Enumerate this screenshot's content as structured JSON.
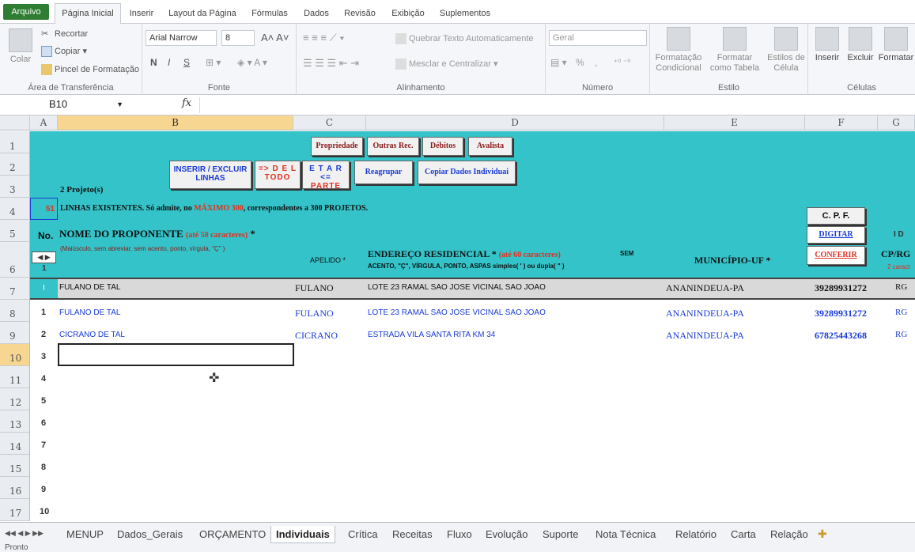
{
  "ribbon_tabs": [
    "Arquivo",
    "Página Inicial",
    "Inserir",
    "Layout da Página",
    "Fórmulas",
    "Dados",
    "Revisão",
    "Exibição",
    "Suplementos"
  ],
  "clipboard": {
    "paste": "Colar",
    "cut": "Recortar",
    "copy": "Copiar ▾",
    "format_painter": "Pincel de Formatação",
    "label": "Área de Transferência"
  },
  "font": {
    "name": "Arial Narrow",
    "size": "8",
    "bold": "N",
    "italic": "I",
    "underline": "S",
    "label": "Fonte"
  },
  "alignment": {
    "wrap": "Quebrar Texto Automaticamente",
    "merge": "Mesclar e Centralizar",
    "label": "Alinhamento"
  },
  "number": {
    "format": "Geral",
    "percent": "%",
    "comma": ",",
    "label": "Número"
  },
  "styles": {
    "conditional": "Formatação Condicional",
    "table": "Formatar como Tabela",
    "cell_styles": "Estilos de Célula",
    "label": "Estilo"
  },
  "cells": {
    "insert": "Inserir",
    "delete": "Excluir",
    "format": "Formatar",
    "label": "Células"
  },
  "formula_bar": {
    "name_box": "B10",
    "fx": "fx"
  },
  "columns": [
    "A",
    "B",
    "C",
    "D",
    "E",
    "F",
    "G"
  ],
  "rows": [
    "1",
    "2",
    "3",
    "4",
    "5",
    "6",
    "7",
    "8",
    "9",
    "10",
    "11",
    "12",
    "13",
    "14",
    "15",
    "16",
    "17"
  ],
  "buttons": {
    "propriedade": "Propriedade",
    "outras": "Outras Rec.",
    "debitos": "Débitos",
    "avalista": "Avalista",
    "inserir": "INSERIR / EXCLUIR LINHAS",
    "deletar_todo_1": "=> D E L",
    "deletar_todo_2": "TODO",
    "deletar_parte_1": "E T A R <=",
    "deletar_parte_2": "PARTE",
    "reagrupar": "Reagrupar",
    "copiar": "Copiar Dados Individuai",
    "digitar": "DIGITAR",
    "conferir": "CONFERIR"
  },
  "sheet": {
    "projetos": "2 Projeto(s)",
    "count": "51",
    "linhas_pre": "LINHAS EXISTENTES.  Só admite, no ",
    "maximo": "MÁXIMO  300",
    "linhas_post": ", correspondentes a 300 PROJETOS.",
    "no": "No.",
    "nome_header": "NOME DO PROPONENTE",
    "nome_limit": "(até 50 caracteres)",
    "star": " *",
    "nome_hint": "(Maiúsculo, sem abreviar, sem acento, ponto, vírgula, \"Ç\" )",
    "apelido": "APELIDO *",
    "endereco_header": "ENDEREÇO RESIDENCIAL *",
    "endereco_limit": "(até 60 caracteres)",
    "sem": "SEM",
    "endereco_hint": "ACENTO,  \"Ç\",  VÍRGULA, PONTO, ASPAS simples( ' ) ou dupla( \" )",
    "municipio": "MUNICÍPIO-UF *",
    "cpf": "C. P. F.",
    "cprg": "CP/RG",
    "caract": "2 caract",
    "id": "I D",
    "row6_num": "1"
  },
  "records": [
    {
      "no": "I",
      "nome": "FULANO DE TAL",
      "apelido": "FULANO",
      "endereco": "LOTE 23 RAMAL SAO JOSE VICINAL SAO JOAO",
      "municipio": "ANANINDEUA-PA",
      "cpf": "39289931272",
      "tipo": "RG"
    },
    {
      "no": "1",
      "nome": "FULANO DE TAL",
      "apelido": "FULANO",
      "endereco": "LOTE 23 RAMAL SAO JOSE VICINAL SAO JOAO",
      "municipio": "ANANINDEUA-PA",
      "cpf": "39289931272",
      "tipo": "RG"
    },
    {
      "no": "2",
      "nome": "CICRANO DE TAL",
      "apelido": "CICRANO",
      "endereco": "ESTRADA VILA SANTA RITA KM 34",
      "municipio": "ANANINDEUA-PA",
      "cpf": "67825443268",
      "tipo": "RG"
    }
  ],
  "row_numbers": [
    "3",
    "4",
    "5",
    "6",
    "7",
    "8",
    "9",
    "10"
  ],
  "sheet_tabs": [
    "MENUP",
    "Dados_Gerais",
    "ORÇAMENTO",
    "Individuais",
    "Crítica",
    "Receitas",
    "Fluxo",
    "Evolução",
    "Suporte",
    "Nota Técnica",
    "Relatório",
    "Carta",
    "Relação"
  ],
  "status": "Pronto"
}
